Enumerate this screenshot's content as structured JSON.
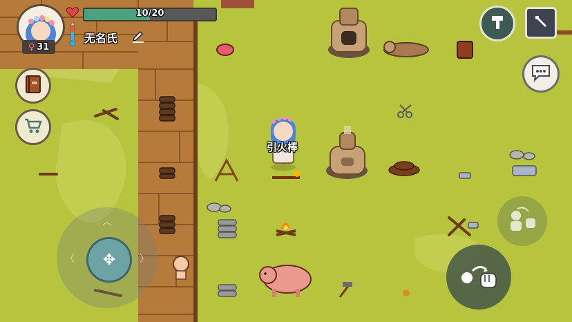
{
  "player": {
    "level": "31",
    "name": "无名氏",
    "health_text": "10/20",
    "health_fraction": 0.5
  },
  "world": {
    "held_item_label": "引火棒"
  },
  "icons": {
    "gender": "female-icon",
    "edit": "pencil-icon",
    "heart": "heart-icon",
    "thermometer": "thermometer-icon",
    "build": "hammer-icon",
    "settings": "wrench-icon",
    "chat": "chat-bubble-icon",
    "book": "book-icon",
    "shop": "shopping-cart-icon",
    "interact": "interact-hand-icon",
    "attack": "punch-fist-icon"
  },
  "colors": {
    "grass": "#b9c63f",
    "wood_floor": "#b77a3b",
    "health_fill": "#4aa37c",
    "health_bg": "#585858"
  }
}
